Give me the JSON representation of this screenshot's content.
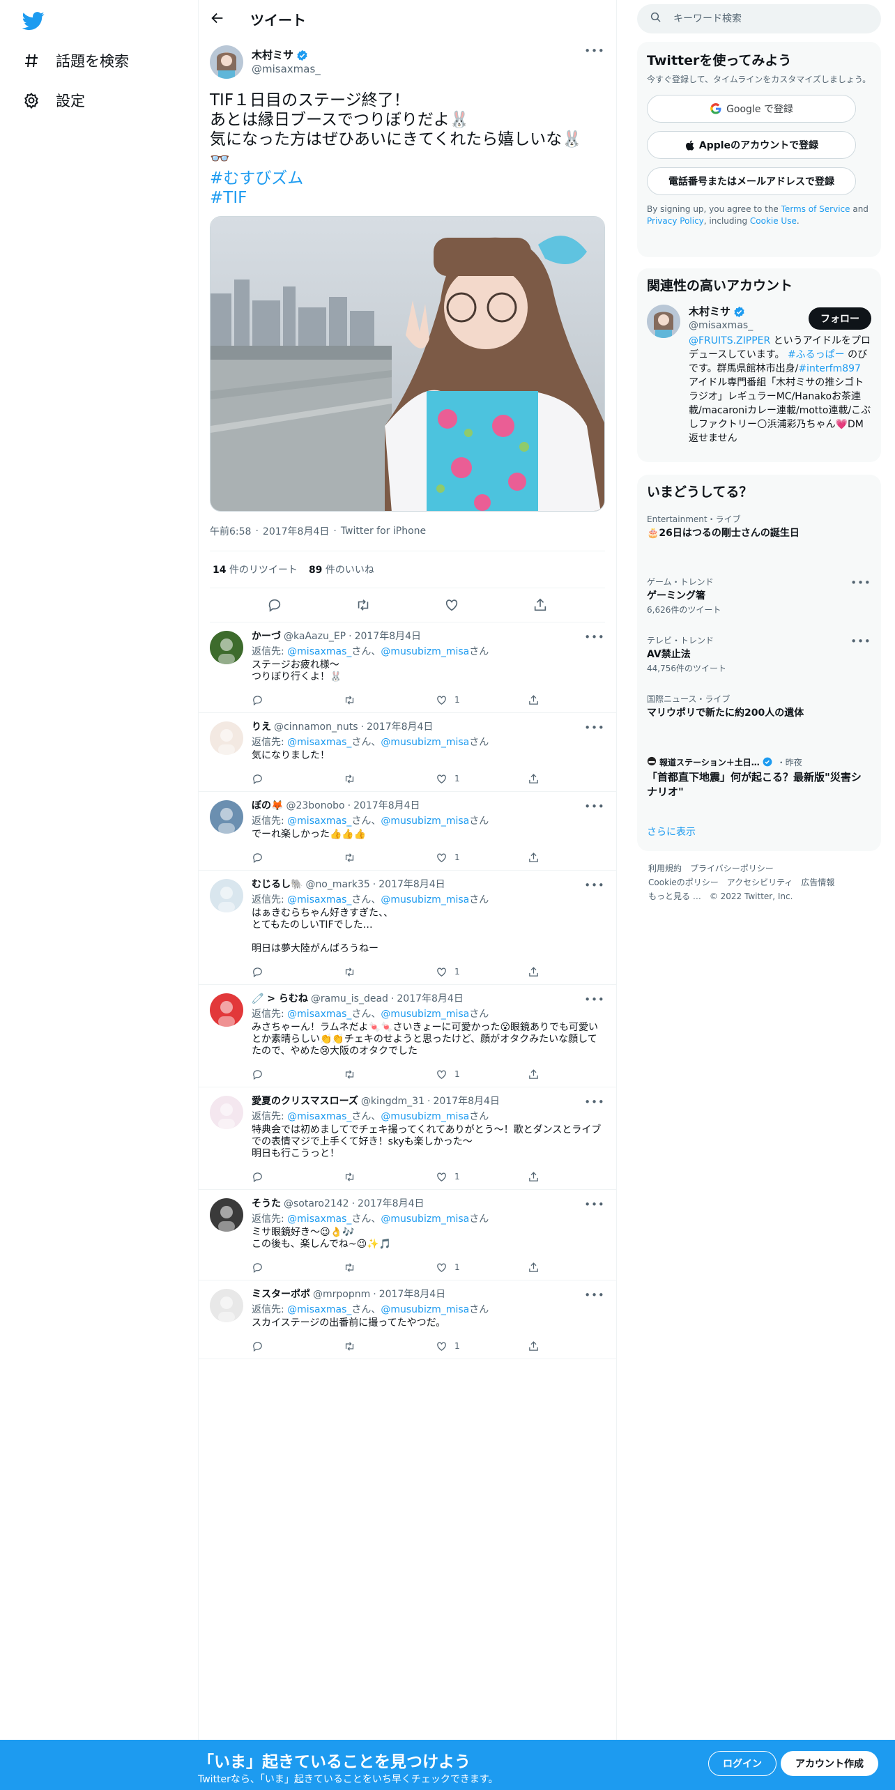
{
  "nav": {
    "items": [
      {
        "label": "話題を検索",
        "icon": "hashtag-icon"
      },
      {
        "label": "設定",
        "icon": "gear-icon"
      }
    ]
  },
  "header": {
    "title": "ツイート"
  },
  "tweet": {
    "author": {
      "name": "木村ミサ",
      "handle": "@misaxmas_",
      "verified": true
    },
    "text": "TIF１日目のステージ終了！\nあとは縁日ブースでつりぼりだよ🐰\n気になった方はぜひあいにきてくれたら嬉しいな🐰\n👓",
    "hashtags": [
      "#むすびズム",
      "#TIF"
    ],
    "time": "午前6:58",
    "date": "2017年8月4日",
    "source": "Twitter for iPhone",
    "retweets": "14",
    "retweets_label": "件のリツイート",
    "likes": "89",
    "likes_label": "件のいいね"
  },
  "reply_to_prefix": "返信先: ",
  "reply_to_mid": "さん、",
  "reply_to_suffix": "さん",
  "replies": [
    {
      "name": "かーづ",
      "handle": "@kaAazu_EP",
      "date": "2017年8月4日",
      "mentions": [
        "@misaxmas_",
        "@musubizm_misa"
      ],
      "text": "ステージお疲れ様〜\nつりぼり行くよ！🐰",
      "likes": "1",
      "avatar_color": "#3d6b2c"
    },
    {
      "name": "りえ",
      "handle": "@cinnamon_nuts",
      "date": "2017年8月4日",
      "mentions": [
        "@misaxmas_",
        "@musubizm_misa"
      ],
      "text": "気になりました！",
      "likes": "1",
      "avatar_color": "#f3e9e2"
    },
    {
      "name": "ぼの🦊",
      "handle": "@23bonobo",
      "date": "2017年8月4日",
      "mentions": [
        "@misaxmas_",
        "@musubizm_misa"
      ],
      "text": "でーれ楽しかった👍👍👍",
      "likes": "1",
      "avatar_color": "#6b8fb0"
    },
    {
      "name": "むじるし🐘",
      "handle": "@no_mark35",
      "date": "2017年8月4日",
      "mentions": [
        "@misaxmas_",
        "@musubizm_misa"
      ],
      "text": "はぁきむらちゃん好きすぎた、、\nとてもたのしいTIFでした…\n\n明日は夢大陸がんばろうねー",
      "likes": "1",
      "avatar_color": "#d9e6ee"
    },
    {
      "name": "🧷 > らむね",
      "handle": "@ramu_is_dead",
      "date": "2017年8月4日",
      "mentions": [
        "@misaxmas_",
        "@musubizm_misa"
      ],
      "text": "みさちゃーん！ラムネだよ🍬🍬さいきょーに可愛かった😮眼鏡ありでも可愛いとか素晴らしい👏👏チェキのせようと思ったけど、顔がオタクみたいな顔してたので、やめた😢大阪のオタクでした",
      "likes": "1",
      "avatar_color": "#e2383a"
    },
    {
      "name": "愛夏のクリスマスローズ",
      "handle": "@kingdm_31",
      "date": "2017年8月4日",
      "mentions": [
        "@misaxmas_",
        "@musubizm_misa"
      ],
      "text": "特典会では初めましてでチェキ撮ってくれてありがとう〜！歌とダンスとライブでの表情マジで上手くて好き！skyも楽しかった〜\n明日も行こうっと！",
      "likes": "1",
      "avatar_color": "#f4e7ef"
    },
    {
      "name": "そうた",
      "handle": "@sotaro2142",
      "date": "2017年8月4日",
      "mentions": [
        "@misaxmas_",
        "@musubizm_misa"
      ],
      "text": "ミサ眼鏡好き～😉👌🎶\nこの後も、楽しんでね~😉✨🎵",
      "likes": "1",
      "avatar_color": "#3a3a3a"
    },
    {
      "name": "ミスターポポ",
      "handle": "@mrpopnm",
      "date": "2017年8月4日",
      "mentions": [
        "@misaxmas_",
        "@musubizm_misa"
      ],
      "text": "スカイステージの出番前に撮ってたやつだ。",
      "likes": "1",
      "avatar_color": "#e8e8e8"
    }
  ],
  "search": {
    "placeholder": "キーワード検索"
  },
  "signup": {
    "title": "Twitterを使ってみよう",
    "desc": "今すぐ登録して、タイムラインをカスタマイズしましょう。",
    "google_label": "Google で登録",
    "apple_label": "Appleのアカウントで登録",
    "phone_label": "電話番号またはメールアドレスで登録",
    "legal_prefix": "By signing up, you agree to the ",
    "tos": "Terms of Service",
    "and": " and ",
    "privacy": "Privacy Policy",
    "including": ", including ",
    "cookie": "Cookie Use",
    "period": "."
  },
  "related": {
    "title": "関連性の高いアカウント",
    "name": "木村ミサ",
    "handle": "@misaxmas_",
    "follow_label": "フォロー",
    "bio_mention": "@FRUITS.ZIPPER",
    "bio_1": " というアイドルをプロデュースしています。 ",
    "bio_tag": "#ふるっぱー",
    "bio_2": " のびです。群馬県館林市出身/",
    "bio_tag2": "#interfm897",
    "bio_3": " アイドル専門番組「木村ミサの推シゴトラジオ」レギュラーMC/Hanakoお茶連載/macaroniカレー連載/motto連載/こぶしファクトリー🌕浜浦彩乃ちゃん💗DM返せません"
  },
  "trends": {
    "title": "いまどうしてる？",
    "items": [
      {
        "meta": "Entertainment・ライブ",
        "title": "🎂26日はつるの剛士さんの誕生日",
        "count": ""
      },
      {
        "meta": "ゲーム・トレンド",
        "title": "ゲーミング箸",
        "count": "6,626件のツイート"
      },
      {
        "meta": "テレビ・トレンド",
        "title": "AV禁止法",
        "count": "44,756件のツイート"
      },
      {
        "meta": "国際ニュース・ライブ",
        "title": "マリウポリで新たに約200人の遺体",
        "count": ""
      },
      {
        "meta": "報道ステーション＋土日…",
        "meta_time": "・昨夜",
        "title": "「首都直下地震」何が起こる？最新版\"災害シナリオ\"",
        "count": ""
      }
    ],
    "show_more": "さらに表示"
  },
  "footer": {
    "links": [
      "利用規約",
      "プライバシーポリシー",
      "Cookieのポリシー",
      "アクセシビリティ",
      "広告情報",
      "もっと見る …",
      "© 2022 Twitter, Inc."
    ]
  },
  "bottombar": {
    "title": "「いま」起きていることを見つけよう",
    "subtitle": "Twitterなら、「いま」起きていることをいち早くチェックできます。",
    "login_label": "ログイン",
    "signup_label": "アカウント作成"
  },
  "colors": {
    "accent": "#1d9bf0",
    "text": "#0f1419",
    "muted": "#536471",
    "border": "#eff3f4"
  }
}
